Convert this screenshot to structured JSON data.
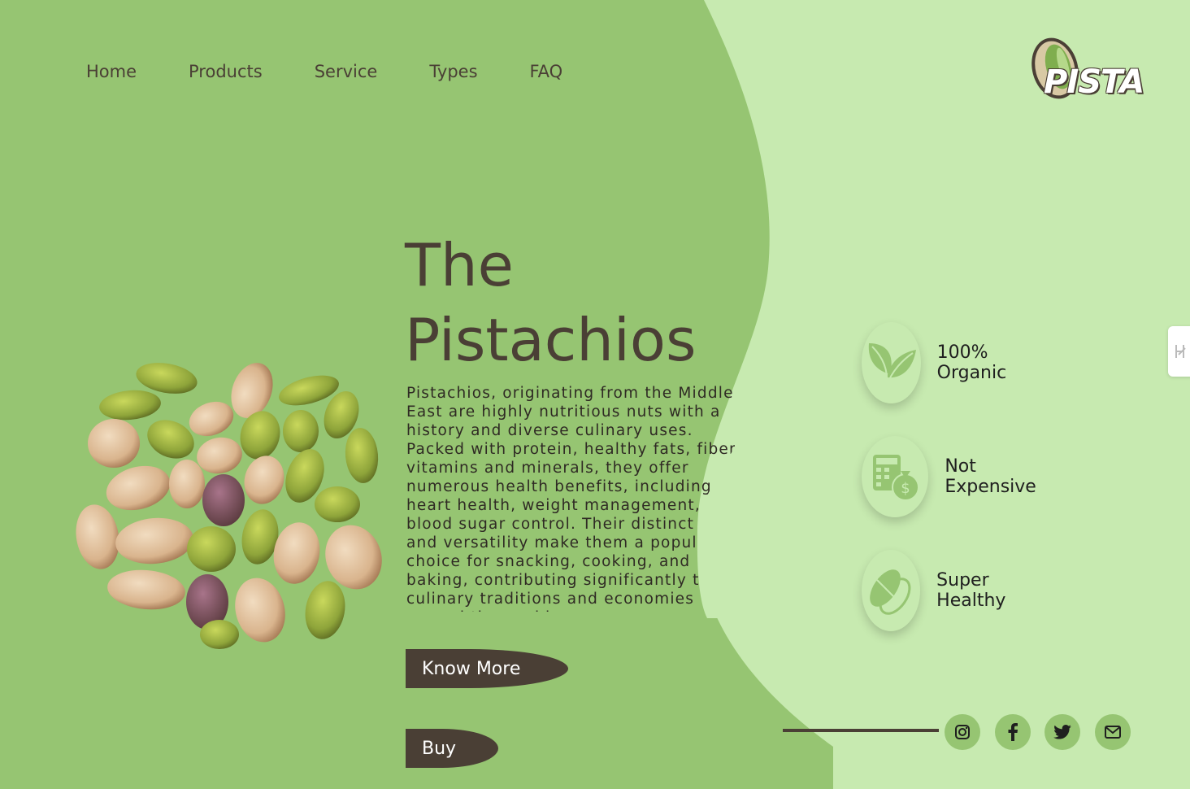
{
  "nav": {
    "items": [
      {
        "label": "Home"
      },
      {
        "label": "Products"
      },
      {
        "label": "Service"
      },
      {
        "label": "Types"
      },
      {
        "label": "FAQ"
      }
    ]
  },
  "logo": {
    "text": "PISTA"
  },
  "hero": {
    "title_line1": "The",
    "title_line2": "Pistachios",
    "description": "Pistachios, originating from the Middle East are highly nutritious nuts with a history and diverse culinary uses. Packed with protein, healthy fats, fiber, vitamins and minerals, they offer numerous health benefits, including heart health, weight management, and blood sugar control. Their distinct flavor and versatility make them a popular choice for snacking, cooking, and baking, contributing significantly to both culinary traditions and economies around the world.",
    "know_more_label": "Know More",
    "buy_label": "Buy"
  },
  "features": [
    {
      "label": "100% Organic",
      "icon": "leaf-icon"
    },
    {
      "label": "Not Expensive",
      "icon": "money-bag-icon"
    },
    {
      "label": "Super Healthy",
      "icon": "pistachio-icon"
    }
  ],
  "social": [
    {
      "icon": "instagram-icon"
    },
    {
      "icon": "facebook-icon"
    },
    {
      "icon": "twitter-icon"
    },
    {
      "icon": "mail-icon"
    }
  ],
  "colors": {
    "background": "#96c572",
    "panel": "#c7eab0",
    "text_dark": "#4a3f35",
    "button": "#4a3f35"
  }
}
